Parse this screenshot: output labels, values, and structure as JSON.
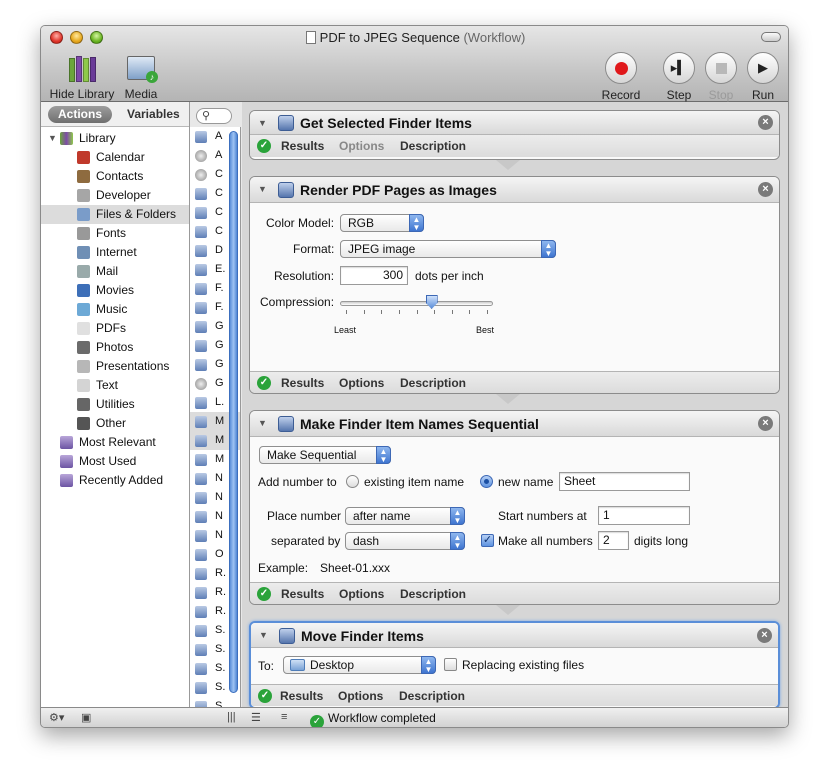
{
  "window": {
    "title": "PDF to JPEG Sequence",
    "title_suffix": "(Workflow)"
  },
  "toolbar": {
    "hide_library": "Hide Library",
    "media": "Media",
    "record": "Record",
    "step": "Step",
    "stop": "Stop",
    "run": "Run"
  },
  "sidebar": {
    "tab_actions": "Actions",
    "tab_variables": "Variables",
    "library_label": "Library",
    "categories": [
      "Calendar",
      "Contacts",
      "Developer",
      "Files & Folders",
      "Fonts",
      "Internet",
      "Mail",
      "Movies",
      "Music",
      "PDFs",
      "Photos",
      "Presentations",
      "Text",
      "Utilities",
      "Other"
    ],
    "selected_category": "Files & Folders",
    "smart_groups": [
      "Most Relevant",
      "Most Used",
      "Recently Added"
    ]
  },
  "action_list": [
    "A",
    "A",
    "C",
    "C",
    "C",
    "C",
    "D",
    "E.",
    "F.",
    "F.",
    "G",
    "G",
    "G",
    "G",
    "L.",
    "M",
    "M",
    "M",
    "N",
    "N",
    "N",
    "N",
    "O",
    "R.",
    "R.",
    "R.",
    "S.",
    "S.",
    "S.",
    "S.",
    "S."
  ],
  "workflow": {
    "footer": {
      "results": "Results",
      "options": "Options",
      "description": "Description"
    },
    "action1": {
      "title": "Get Selected Finder Items"
    },
    "action2": {
      "title": "Render PDF Pages as Images",
      "color_model_label": "Color Model:",
      "color_model": "RGB",
      "format_label": "Format:",
      "format": "JPEG image",
      "resolution_label": "Resolution:",
      "resolution": "300",
      "resolution_unit": "dots per inch",
      "compression_label": "Compression:",
      "compression_level": 0.65,
      "least": "Least",
      "best": "Best"
    },
    "action3": {
      "title": "Make Finder Item Names Sequential",
      "mode": "Make Sequential",
      "add_number_label": "Add number to",
      "existing_item_name": "existing item name",
      "new_name_label": "new name",
      "new_name_value": "Sheet",
      "place_number_label": "Place number",
      "place_number": "after name",
      "separated_by_label": "separated by",
      "separated_by": "dash",
      "start_numbers_label": "Start numbers at",
      "start_numbers_value": "1",
      "make_all_numbers_label": "Make all numbers",
      "digits_value": "2",
      "digits_long": "digits long",
      "example_label": "Example:",
      "example_value": "Sheet-01.xxx"
    },
    "action4": {
      "title": "Move Finder Items",
      "to_label": "To:",
      "destination": "Desktop",
      "replacing_label": "Replacing existing files"
    }
  },
  "status": {
    "text": "Workflow completed"
  },
  "colors": {
    "accent": "#5a8ed8",
    "success": "#2aa33a",
    "record": "#e0181b"
  }
}
